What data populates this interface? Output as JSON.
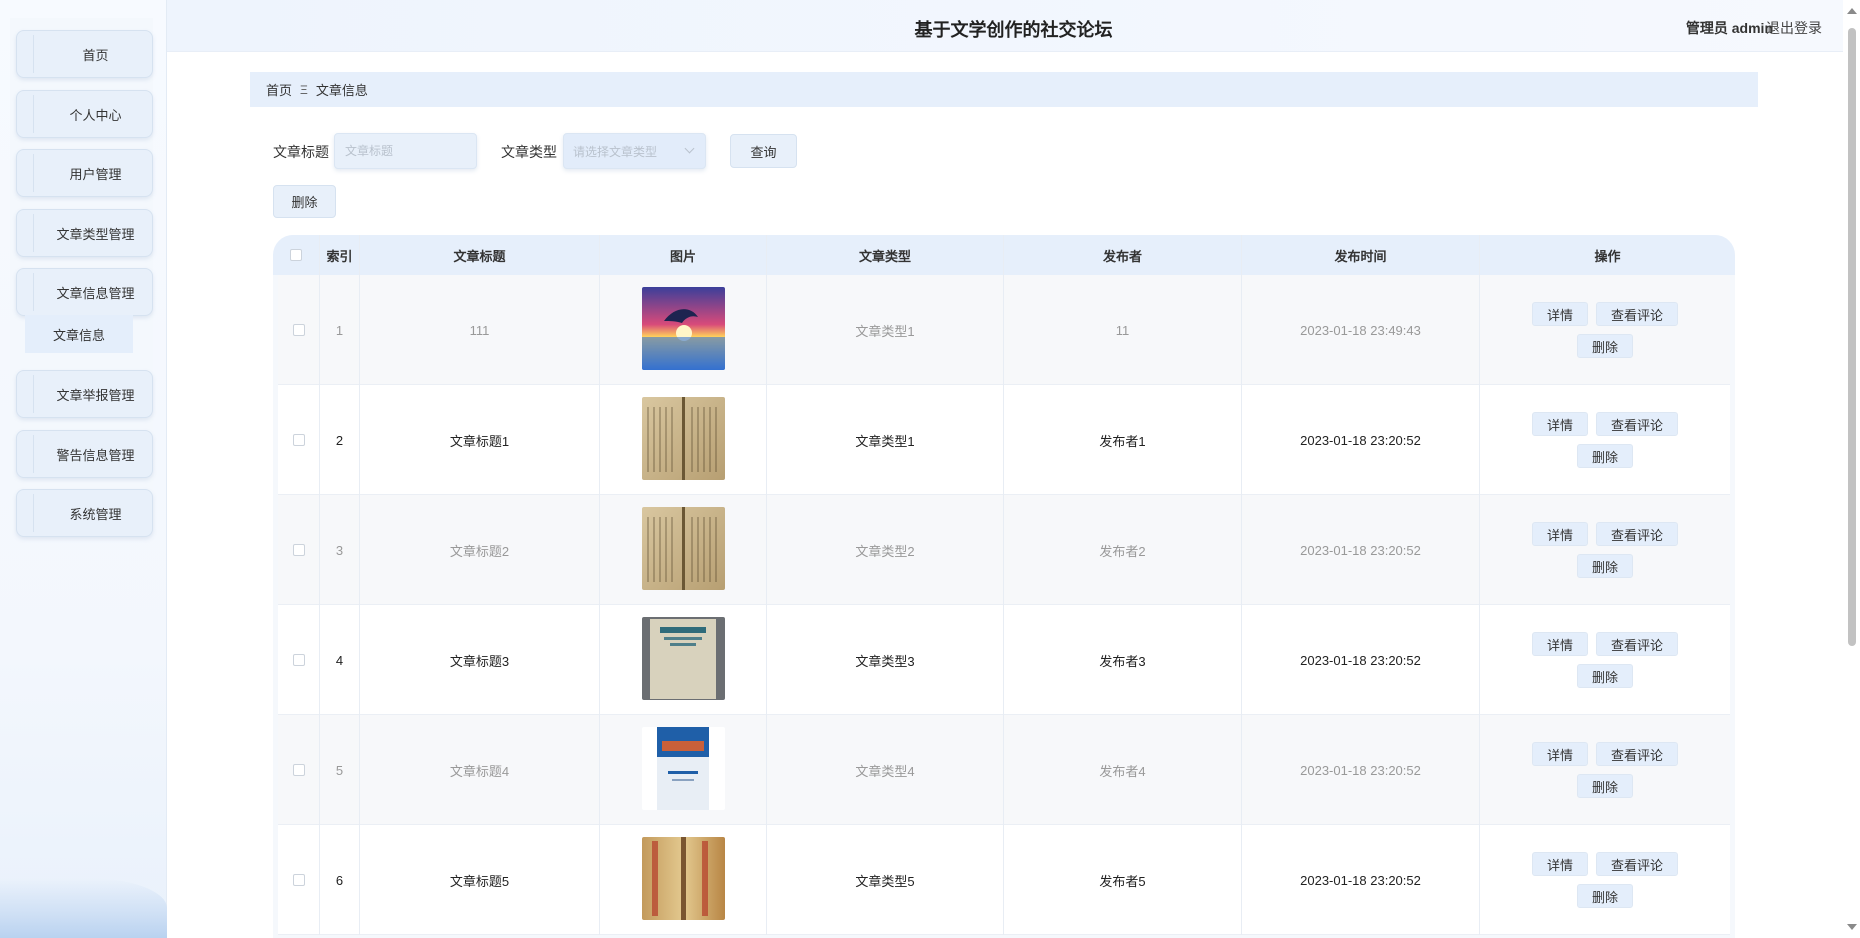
{
  "header": {
    "title": "基于文学创作的社交论坛",
    "user_role": "管理员",
    "user_name": "admin",
    "logout": "退出登录"
  },
  "sidebar": {
    "items": [
      {
        "label": "首页"
      },
      {
        "label": "个人中心"
      },
      {
        "label": "用户管理"
      },
      {
        "label": "文章类型管理"
      },
      {
        "label": "文章信息管理"
      },
      {
        "label": "文章举报管理"
      },
      {
        "label": "警告信息管理"
      },
      {
        "label": "系统管理"
      }
    ],
    "submenu": {
      "label": "文章信息"
    }
  },
  "breadcrumb": {
    "home": "首页",
    "separator": "Ξ",
    "current": "文章信息"
  },
  "search": {
    "title_label": "文章标题",
    "title_placeholder": "文章标题",
    "type_label": "文章类型",
    "type_placeholder": "请选择文章类型",
    "query_button": "查询"
  },
  "toolbar": {
    "delete_button": "删除"
  },
  "table": {
    "columns": [
      "索引",
      "文章标题",
      "图片",
      "文章类型",
      "发布者",
      "发布时间",
      "操作"
    ],
    "rows": [
      {
        "index": "1",
        "title": "111",
        "type": "文章类型1",
        "author": "11",
        "time": "2023-01-18 23:49:43",
        "image": "dolphin-sunset"
      },
      {
        "index": "2",
        "title": "文章标题1",
        "type": "文章类型1",
        "author": "发布者1",
        "time": "2023-01-18 23:20:52",
        "image": "old-book"
      },
      {
        "index": "3",
        "title": "文章标题2",
        "type": "文章类型2",
        "author": "发布者2",
        "time": "2023-01-18 23:20:52",
        "image": "old-book"
      },
      {
        "index": "4",
        "title": "文章标题3",
        "type": "文章类型3",
        "author": "发布者3",
        "time": "2023-01-18 23:20:52",
        "image": "worn-book"
      },
      {
        "index": "5",
        "title": "文章标题4",
        "type": "文章类型4",
        "author": "发布者4",
        "time": "2023-01-18 23:20:52",
        "image": "blue-textbook"
      },
      {
        "index": "6",
        "title": "文章标题5",
        "type": "文章类型5",
        "author": "发布者5",
        "time": "2023-01-18 23:20:52",
        "image": "scroll-book"
      }
    ],
    "actions": {
      "detail": "详情",
      "comments": "查看评论",
      "delete": "删除"
    }
  }
}
